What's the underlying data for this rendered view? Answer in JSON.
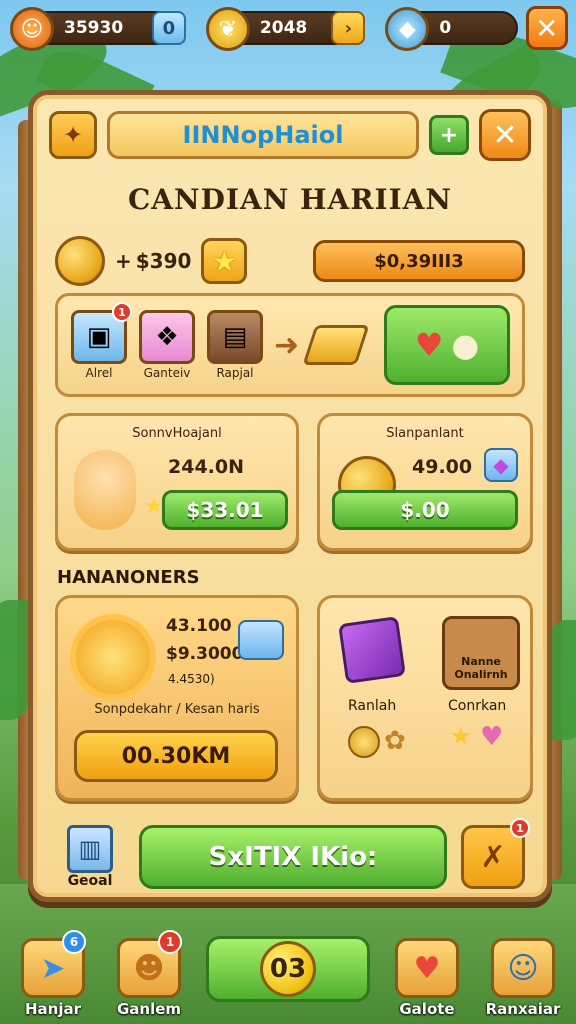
{
  "top_bar": {
    "resources": [
      {
        "value": "35930",
        "icon": "sun-face-icon",
        "action_icon": "plus-icon"
      },
      {
        "value": "2048",
        "icon": "leaf-shield-icon",
        "action_icon": "arrow-right-icon"
      },
      {
        "value": "0",
        "icon": "gem-icon",
        "action_icon": "close-icon"
      }
    ]
  },
  "panel": {
    "title": "IINNopHaiol",
    "subtitle": "CANDIAN HARIIAN",
    "coin_row": {
      "prefix": "+",
      "amount": "$390",
      "price": "$0,39III3"
    },
    "recipe": {
      "slots": [
        {
          "label": "Alrel",
          "badge": "1",
          "icon": "ice-block-icon"
        },
        {
          "label": "Ganteiv",
          "badge": "",
          "icon": "candy-box-icon"
        },
        {
          "label": "Rapjal",
          "badge": "",
          "icon": "chocolate-icon"
        }
      ]
    },
    "offers": [
      {
        "title": "SonnvHoajanl",
        "amount": "244.0N",
        "button": "$33.01"
      },
      {
        "title": "Slanpanlant",
        "amount": "49.00",
        "button": "$.00"
      }
    ],
    "section_label": "HANANONERS",
    "featured": {
      "line1": "43.100",
      "line2": "$9.3000",
      "line3": "4.4530)",
      "desc": "Sonpdekahr / Kesan haris",
      "cta": "00.30KM"
    },
    "bundle": {
      "label_left": "Ranlah",
      "label_right": "Conrkan",
      "sign": "Nanne Onalirnh"
    },
    "bottom": {
      "trash_label": "Geoal",
      "main_button": "SxITIX IKio:",
      "wrench_badge": "1"
    }
  },
  "nav": {
    "items": [
      {
        "label": "Hanjar",
        "badge": "6"
      },
      {
        "label": "Ganlem",
        "badge": "1"
      },
      {
        "label": "Galote",
        "badge": ""
      },
      {
        "label": "Ranxaiar",
        "badge": ""
      }
    ],
    "center_value": "03"
  },
  "colors": {
    "panel_bg": "#f6d891",
    "panel_border": "#8a5a2a",
    "green": "#4fb02e",
    "orange": "#f0a010",
    "title_blue": "#1f8fd6"
  }
}
